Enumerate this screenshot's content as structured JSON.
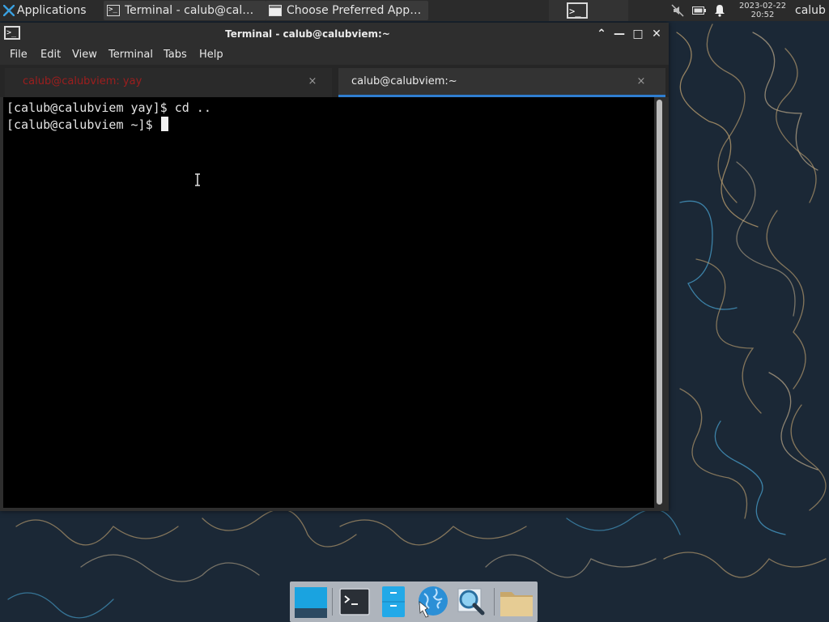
{
  "panel": {
    "applications_label": "Applications",
    "tasks": [
      {
        "label": "Terminal - calub@cal…"
      },
      {
        "label": "Choose Preferred App…"
      }
    ],
    "clock_date": "2023-02-22",
    "clock_time": "20:52",
    "user": "calub"
  },
  "window": {
    "title": "Terminal - calub@calubviem:~",
    "controls": {
      "shade": "⌃",
      "minimize": "—",
      "maximize": "□",
      "close": "✕"
    }
  },
  "menu": [
    "File",
    "Edit",
    "View",
    "Terminal",
    "Tabs",
    "Help"
  ],
  "tabs": [
    {
      "label": "calub@calubviem: yay",
      "active": false,
      "close": "×"
    },
    {
      "label": "calub@calubviem:~",
      "active": true,
      "close": "×"
    }
  ],
  "terminal": {
    "lines": [
      "[calub@calubviem yay]$ cd ..",
      "[calub@calubviem ~]$ "
    ],
    "prompt_icon": ">_"
  },
  "colors": {
    "accent": "#2f7ed0",
    "inactive_tab_text": "#c21a1a",
    "panel_bg": "#2b2b2b",
    "desktop_bg": "#1b2836"
  },
  "dock": [
    {
      "icon": "desktop-icon"
    },
    {
      "icon": "terminal-icon"
    },
    {
      "icon": "file-manager-icon"
    },
    {
      "icon": "web-browser-icon"
    },
    {
      "icon": "app-finder-icon"
    },
    {
      "icon": "folder-icon"
    }
  ]
}
